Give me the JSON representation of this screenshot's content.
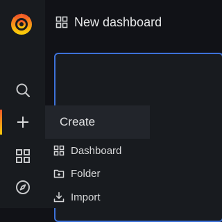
{
  "header": {
    "title": "New dashboard",
    "icon": "dashboard-grid-icon"
  },
  "sidebar": {
    "logo": "grafana-logo",
    "items": [
      {
        "name": "search",
        "icon": "search-icon"
      },
      {
        "name": "create",
        "icon": "plus-icon",
        "active": true
      },
      {
        "name": "dashboards",
        "icon": "dashboards-grid-icon"
      },
      {
        "name": "explore",
        "icon": "compass-icon"
      }
    ]
  },
  "create_menu": {
    "header": "Create",
    "items": [
      {
        "label": "Dashboard",
        "icon": "dashboard-grid-icon"
      },
      {
        "label": "Folder",
        "icon": "folder-plus-icon"
      },
      {
        "label": "Import",
        "icon": "import-icon"
      }
    ]
  },
  "colors": {
    "background": "#111217",
    "sidebar": "#181b1f",
    "accent_orange": "#f05a28",
    "accent_yellow": "#fbca0a",
    "panel_border": "#3d71d9"
  }
}
